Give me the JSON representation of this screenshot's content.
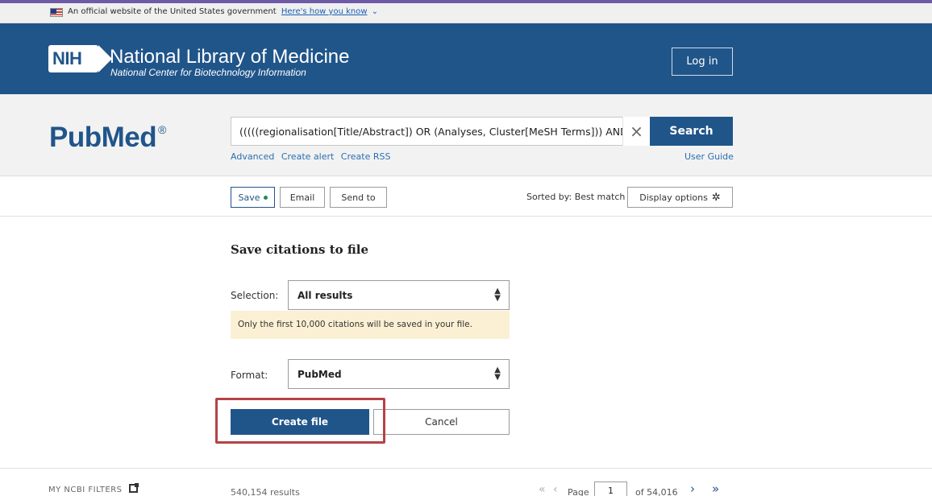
{
  "banner": {
    "text": "An official website of the United States government",
    "link": "Here's how you know",
    "chevron": "⌄"
  },
  "header": {
    "logo_text": "NIH",
    "title": "National Library of Medicine",
    "subtitle": "National Center for Biotechnology Information",
    "login_label": "Log in"
  },
  "search": {
    "logo_text": "PubMed",
    "logo_reg": "®",
    "query": "(((((regionalisation[Title/Abstract]) OR (Analyses, Cluster[MeSH Terms])) AND",
    "clear_icon": "×",
    "button_label": "Search",
    "links": [
      "Advanced",
      "Create alert",
      "Create RSS"
    ],
    "user_guide": "User Guide"
  },
  "actions": {
    "save_label": "Save",
    "email_label": "Email",
    "send_to_label": "Send to",
    "sorted_by": "Sorted by: Best match",
    "display_options": "Display options"
  },
  "save_panel": {
    "title": "Save citations to file",
    "selection_label": "Selection:",
    "selection_value": "All results",
    "notice": "Only the first 10,000 citations will be saved in your file.",
    "format_label": "Format:",
    "format_value": "PubMed",
    "create_label": "Create file",
    "cancel_label": "Cancel"
  },
  "footer": {
    "my_ncbi_filters": "MY NCBI FILTERS",
    "results_count": "540,154 results",
    "page_label": "Page",
    "page_value": "1",
    "page_of": "of 54,016"
  },
  "colors": {
    "brand": "#20558a",
    "notice_bg": "#fbf0d3",
    "highlight": "#b44347"
  }
}
